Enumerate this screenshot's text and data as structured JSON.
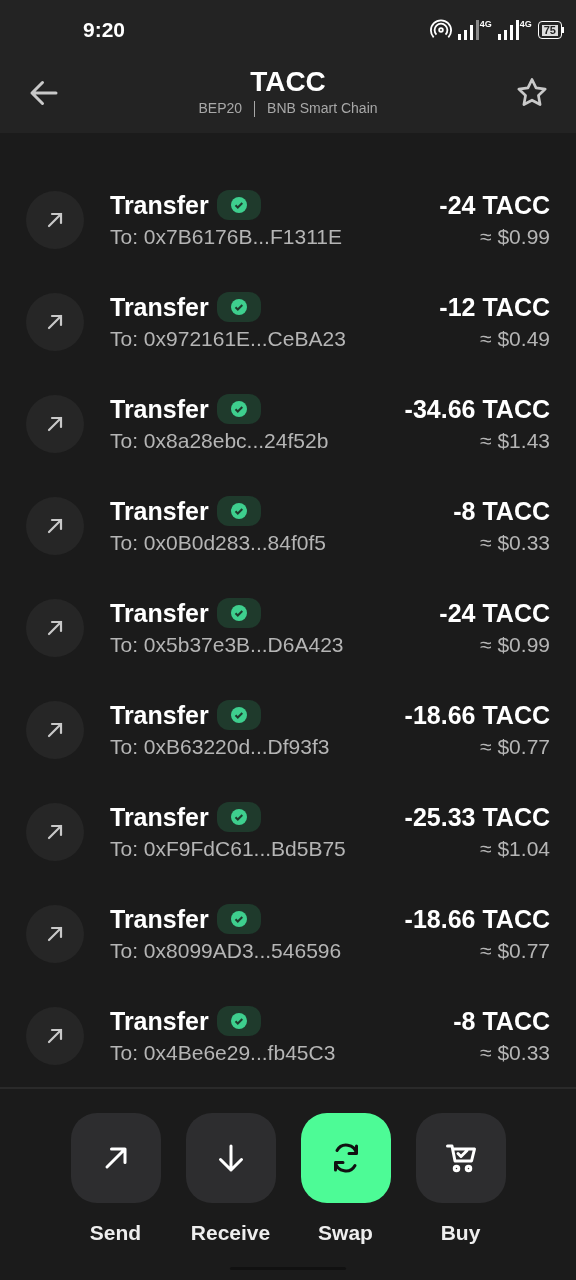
{
  "status_bar": {
    "time": "9:20",
    "network_labels": [
      "4G",
      "4G"
    ],
    "battery": "75"
  },
  "header": {
    "title": "TACC",
    "standard": "BEP20",
    "network": "BNB Smart Chain"
  },
  "transactions": [
    {
      "title": "Transfer",
      "address": "To: 0x7B6176B...F1311E",
      "amount": "-24 TACC",
      "value": "≈ $0.99",
      "confirmed": true
    },
    {
      "title": "Transfer",
      "address": "To: 0x972161E...CeBA23",
      "amount": "-12 TACC",
      "value": "≈ $0.49",
      "confirmed": true
    },
    {
      "title": "Transfer",
      "address": "To: 0x8a28ebc...24f52b",
      "amount": "-34.66 TACC",
      "value": "≈ $1.43",
      "confirmed": true
    },
    {
      "title": "Transfer",
      "address": "To: 0x0B0d283...84f0f5",
      "amount": "-8 TACC",
      "value": "≈ $0.33",
      "confirmed": true
    },
    {
      "title": "Transfer",
      "address": "To: 0x5b37e3B...D6A423",
      "amount": "-24 TACC",
      "value": "≈ $0.99",
      "confirmed": true
    },
    {
      "title": "Transfer",
      "address": "To: 0xB63220d...Df93f3",
      "amount": "-18.66 TACC",
      "value": "≈ $0.77",
      "confirmed": true
    },
    {
      "title": "Transfer",
      "address": "To: 0xF9FdC61...Bd5B75",
      "amount": "-25.33 TACC",
      "value": "≈ $1.04",
      "confirmed": true
    },
    {
      "title": "Transfer",
      "address": "To: 0x8099AD3...546596",
      "amount": "-18.66 TACC",
      "value": "≈ $0.77",
      "confirmed": true
    },
    {
      "title": "Transfer",
      "address": "To: 0x4Be6e29...fb45C3",
      "amount": "-8 TACC",
      "value": "≈ $0.33",
      "confirmed": true
    }
  ],
  "actions": [
    {
      "kind": "send",
      "label": "Send",
      "selected": false
    },
    {
      "kind": "receive",
      "label": "Receive",
      "selected": false
    },
    {
      "kind": "swap",
      "label": "Swap",
      "selected": true
    },
    {
      "kind": "buy",
      "label": "Buy",
      "selected": false
    }
  ]
}
